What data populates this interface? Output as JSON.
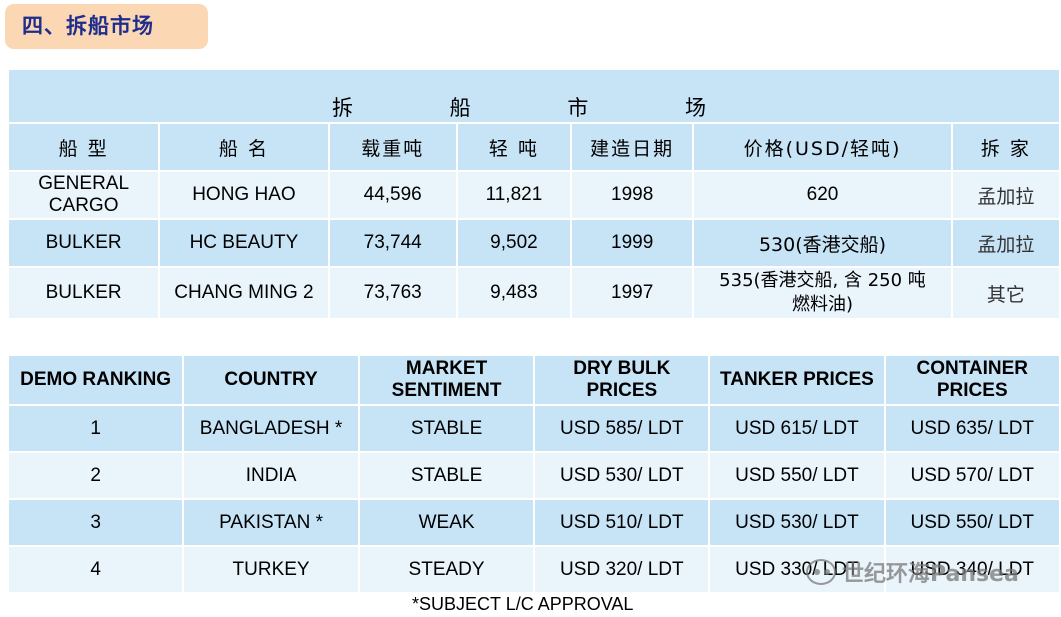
{
  "section_title": "四、拆船市场",
  "table1": {
    "title": "拆 船 市 场",
    "headers": [
      "船  型",
      "船  名",
      "载重吨",
      "轻  吨",
      "建造日期",
      "价格(USD/轻吨)",
      "拆  家"
    ],
    "rows": [
      [
        "GENERAL CARGO",
        "HONG HAO",
        "44,596",
        "11,821",
        "1998",
        "620",
        "孟加拉"
      ],
      [
        "BULKER",
        "HC BEAUTY",
        "73,744",
        "9,502",
        "1999",
        "530(香港交船)",
        "孟加拉"
      ],
      [
        "BULKER",
        "CHANG MING 2",
        "73,763",
        "9,483",
        "1997",
        "535(香港交船, 含 250 吨燃料油)",
        "其它"
      ]
    ]
  },
  "table2": {
    "headers": [
      "DEMO RANKING",
      "COUNTRY",
      "MARKET SENTIMENT",
      "DRY BULK PRICES",
      "TANKER PRICES",
      "CONTAINER PRICES"
    ],
    "rows": [
      [
        "1",
        "BANGLADESH *",
        "STABLE",
        "USD 585/ LDT",
        "USD 615/ LDT",
        "USD 635/ LDT"
      ],
      [
        "2",
        "INDIA",
        "STABLE",
        "USD 530/ LDT",
        "USD 550/ LDT",
        "USD 570/ LDT"
      ],
      [
        "3",
        "PAKISTAN *",
        "WEAK",
        "USD 510/ LDT",
        "USD 530/ LDT",
        "USD 550/ LDT"
      ],
      [
        "4",
        "TURKEY",
        "STEADY",
        "USD 320/ LDT",
        "USD 330/ LDT",
        "USD 340/ LDT"
      ]
    ]
  },
  "footnote": "*SUBJECT L/C APPROVAL",
  "watermark": {
    "icon": "wechat-icon",
    "text": "世纪环海Pansea"
  },
  "colors": {
    "header_bg": "#c7e3f6",
    "row_light": "#eaf4fb",
    "section_bg": "#fbd7b4",
    "section_text": "#1f2d8c"
  }
}
